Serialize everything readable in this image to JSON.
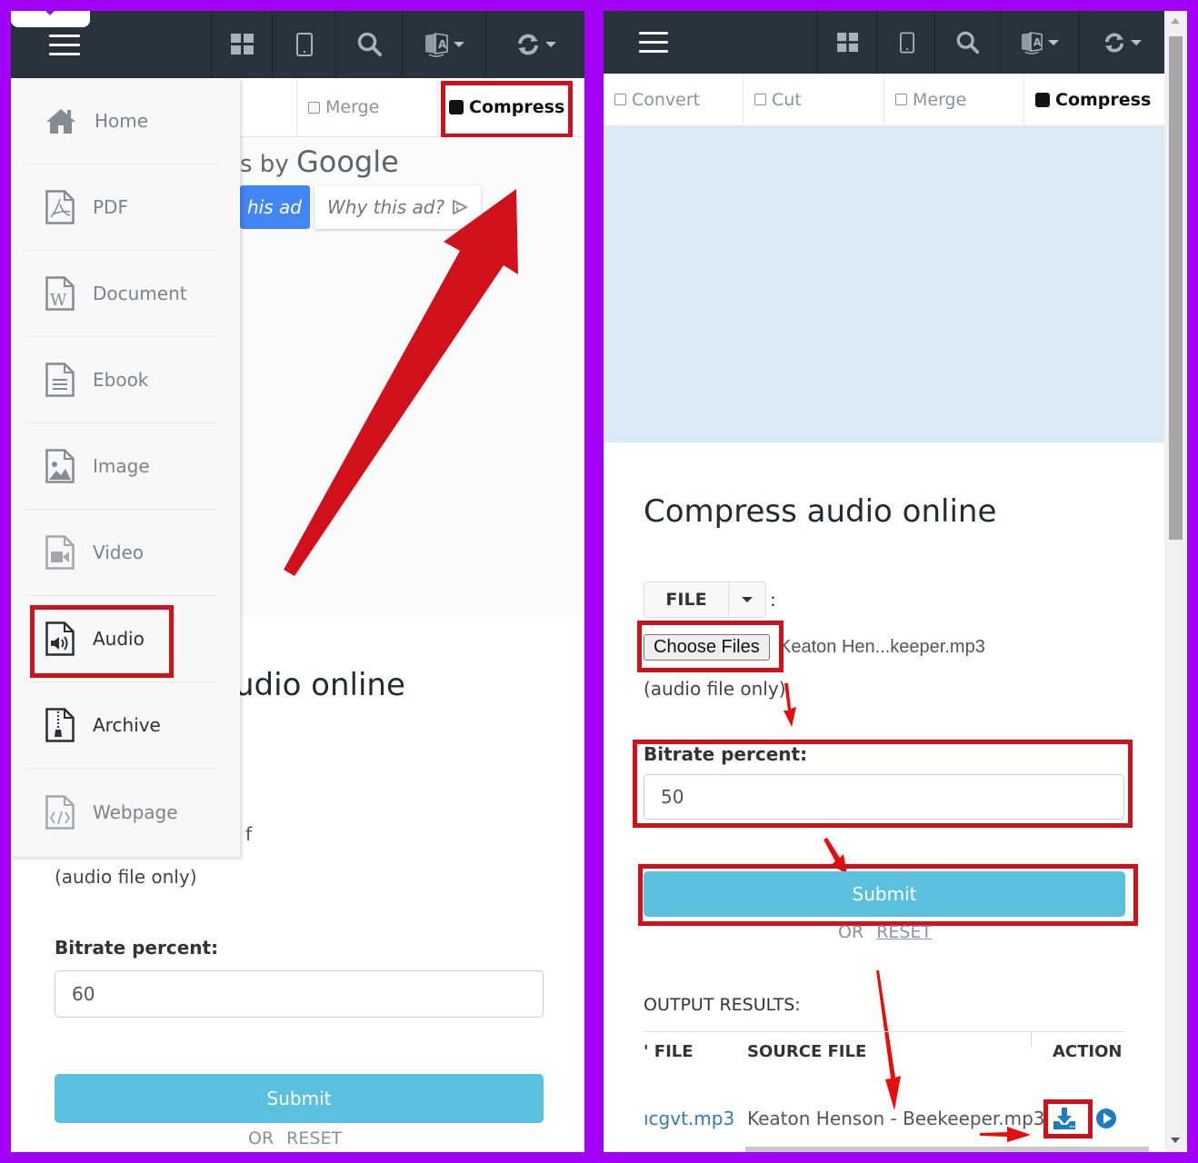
{
  "colors": {
    "frame": "#a100f5",
    "topbar": "#27323c",
    "highlight": "#d0111c",
    "submit": "#5bc0de",
    "ad_placeholder": "#dbeaf4",
    "link": "#337ab7"
  },
  "left": {
    "topbar": {
      "icons": [
        "menu-icon",
        "grid-icon",
        "tablet-icon",
        "search-icon",
        "translate-icon",
        "refresh-icon"
      ]
    },
    "tabs": [
      {
        "label": "Merge",
        "active": false
      },
      {
        "label": "Compress",
        "active": true
      }
    ],
    "ad": {
      "ads_by_prefix": "s by",
      "ads_by_brand": "Google",
      "stop_label": "his ad",
      "why_label": "Why this ad?"
    },
    "sidebar": {
      "items": [
        {
          "label": "Home",
          "icon": "home-icon"
        },
        {
          "label": "PDF",
          "icon": "pdf-file-icon"
        },
        {
          "label": "Document",
          "icon": "word-file-icon"
        },
        {
          "label": "Ebook",
          "icon": "ebook-file-icon"
        },
        {
          "label": "Image",
          "icon": "image-file-icon"
        },
        {
          "label": "Video",
          "icon": "video-file-icon"
        },
        {
          "label": "Audio",
          "icon": "audio-file-icon",
          "highlighted": true
        },
        {
          "label": "Archive",
          "icon": "archive-file-icon"
        },
        {
          "label": "Webpage",
          "icon": "webpage-file-icon"
        }
      ]
    },
    "heading_partial": "udio online",
    "file_fragment": "f",
    "file_hint": "(audio file only)",
    "bitrate_label": "Bitrate percent:",
    "bitrate_value": "60",
    "submit_label": "Submit",
    "or_label": "OR",
    "reset_label": "RESET"
  },
  "right": {
    "tabs": [
      {
        "label": "Convert",
        "active": false
      },
      {
        "label": "Cut",
        "active": false
      },
      {
        "label": "Merge",
        "active": false
      },
      {
        "label": "Compress",
        "active": true
      }
    ],
    "heading": "Compress audio online",
    "file_source_label": "FILE",
    "file_source_colon": ":",
    "choose_files_label": "Choose Files",
    "chosen_file": "Keaton Hen...keeper.mp3",
    "file_hint": "(audio file only)",
    "bitrate_label": "Bitrate percent:",
    "bitrate_value": "50",
    "submit_label": "Submit",
    "or_label": "OR",
    "reset_label": "RESET",
    "output": {
      "title": "OUTPUT RESULTS:",
      "columns": [
        "' FILE",
        "SOURCE FILE",
        "ACTION"
      ],
      "rows": [
        {
          "output_file": "ıcgvt.mp3",
          "source_file": "Keaton Henson - Beekeeper.mp3",
          "actions": [
            "download-icon",
            "play-icon"
          ]
        }
      ]
    }
  }
}
